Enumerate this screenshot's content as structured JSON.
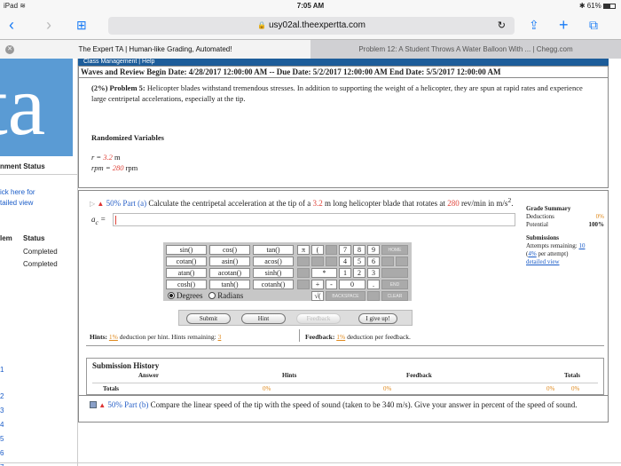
{
  "status_bar": {
    "device": "iPad",
    "wifi": "wifi-icon",
    "time": "7:05 AM",
    "battery_pct": "61%",
    "battery_level": 0.61
  },
  "browser": {
    "url": "usy02al.theexpertta.com",
    "tabs": [
      {
        "title": "The Expert TA | Human-like Grading, Automated!",
        "active": true
      },
      {
        "title": "Problem 12: A Student Throws A Water Balloon With ... | Chegg.com",
        "active": false
      }
    ]
  },
  "sidebar": {
    "logo_text": "ta",
    "status_heading": "nment Status",
    "link_line1": "ick here for",
    "link_line2": "tailed view",
    "col_item": "lem",
    "col_status": "Status",
    "rows": [
      "Completed",
      "Completed"
    ],
    "marks": [
      "1",
      "2",
      "3",
      "4",
      "5",
      "6",
      "7"
    ]
  },
  "header": {
    "class_mgmt": "Class Management  |  Help",
    "assignment": "Waves and Review Begin Date: 4/28/2017 12:00:00 AM -- Due Date: 5/2/2017 12:00:00 AM End Date: 5/5/2017 12:00:00 AM"
  },
  "problem": {
    "weight": "(2%) Problem 5:",
    "text": "Helicopter blades withstand tremendous stresses. In addition to supporting the weight of a helicopter, they are spun at rapid rates and experience large centripetal accelerations, especially at the tip.",
    "rv_title": "Randomized Variables",
    "r_label": "r = ",
    "r_value": "3.2",
    "r_unit": " m",
    "rpm_label": "rpm = ",
    "rpm_value": "280",
    "rpm_unit": " rpm"
  },
  "part_a": {
    "label": "50% Part (a)",
    "text1": "Calculate the centripetal acceleration at the tip of a ",
    "value1": "3.2",
    "text2": " m long helicopter blade that rotates at ",
    "value2": "280",
    "text3": " rev/min in m/s",
    "sup": "2",
    "text4": ".",
    "input_label": "a",
    "input_sub": "c",
    "input_eq": " ="
  },
  "grade_summary": {
    "title": "Grade Summary",
    "deductions_label": "Deductions",
    "deductions_value": "0%",
    "potential_label": "Potential",
    "potential_value": "100%",
    "submissions_title": "Submissions",
    "attempts_label": "Attempts remaining: ",
    "attempts_value": "10",
    "per_attempt_pct": "4%",
    "per_attempt_text": " per attempt)",
    "detailed": "detailed view"
  },
  "calculator": {
    "funcs": [
      [
        "sin()",
        "cos()",
        "tan()"
      ],
      [
        "cotan()",
        "asin()",
        "acos()"
      ],
      [
        "atan()",
        "acotan()",
        "sinh()"
      ],
      [
        "cosh()",
        "tanh()",
        "cotanh()"
      ]
    ],
    "pi": "π",
    "paren": "(",
    "digits": [
      [
        "7",
        "8",
        "9"
      ],
      [
        "4",
        "5",
        "6"
      ],
      [
        "*",
        "1",
        "2",
        "3"
      ],
      [
        "+",
        "-",
        "0",
        "."
      ]
    ],
    "sqrt": "√(",
    "home": "HOME",
    "end": "END",
    "backspace": "BACKSPACE",
    "clear": "CLEAR",
    "degrees": "Degrees",
    "radians": "Radians"
  },
  "actions": {
    "submit": "Submit",
    "hint": "Hint",
    "feedback": "Feedback",
    "give_up": "I give up!"
  },
  "hints_line": {
    "label": "Hints: ",
    "pct": "1%",
    "text": " deduction per hint. Hints remaining: ",
    "remaining": "3"
  },
  "feedback_line": {
    "label": "Feedback: ",
    "pct": "1%",
    "text": " deduction per feedback."
  },
  "submission_history": {
    "title": "Submission History",
    "col_answer": "Answer",
    "col_hints": "Hints",
    "col_feedback": "Feedback",
    "col_totals": "Totals",
    "row_label": "Totals",
    "hints_pct": "0%",
    "feedback_pct": "0%",
    "totals_pct1": "0%",
    "totals_pct2": "0%"
  },
  "part_b": {
    "label": "50% Part (b)",
    "text": "Compare the linear speed of the tip with the speed of sound (taken to be 340 m/s). Give your answer in percent of the speed of sound."
  }
}
